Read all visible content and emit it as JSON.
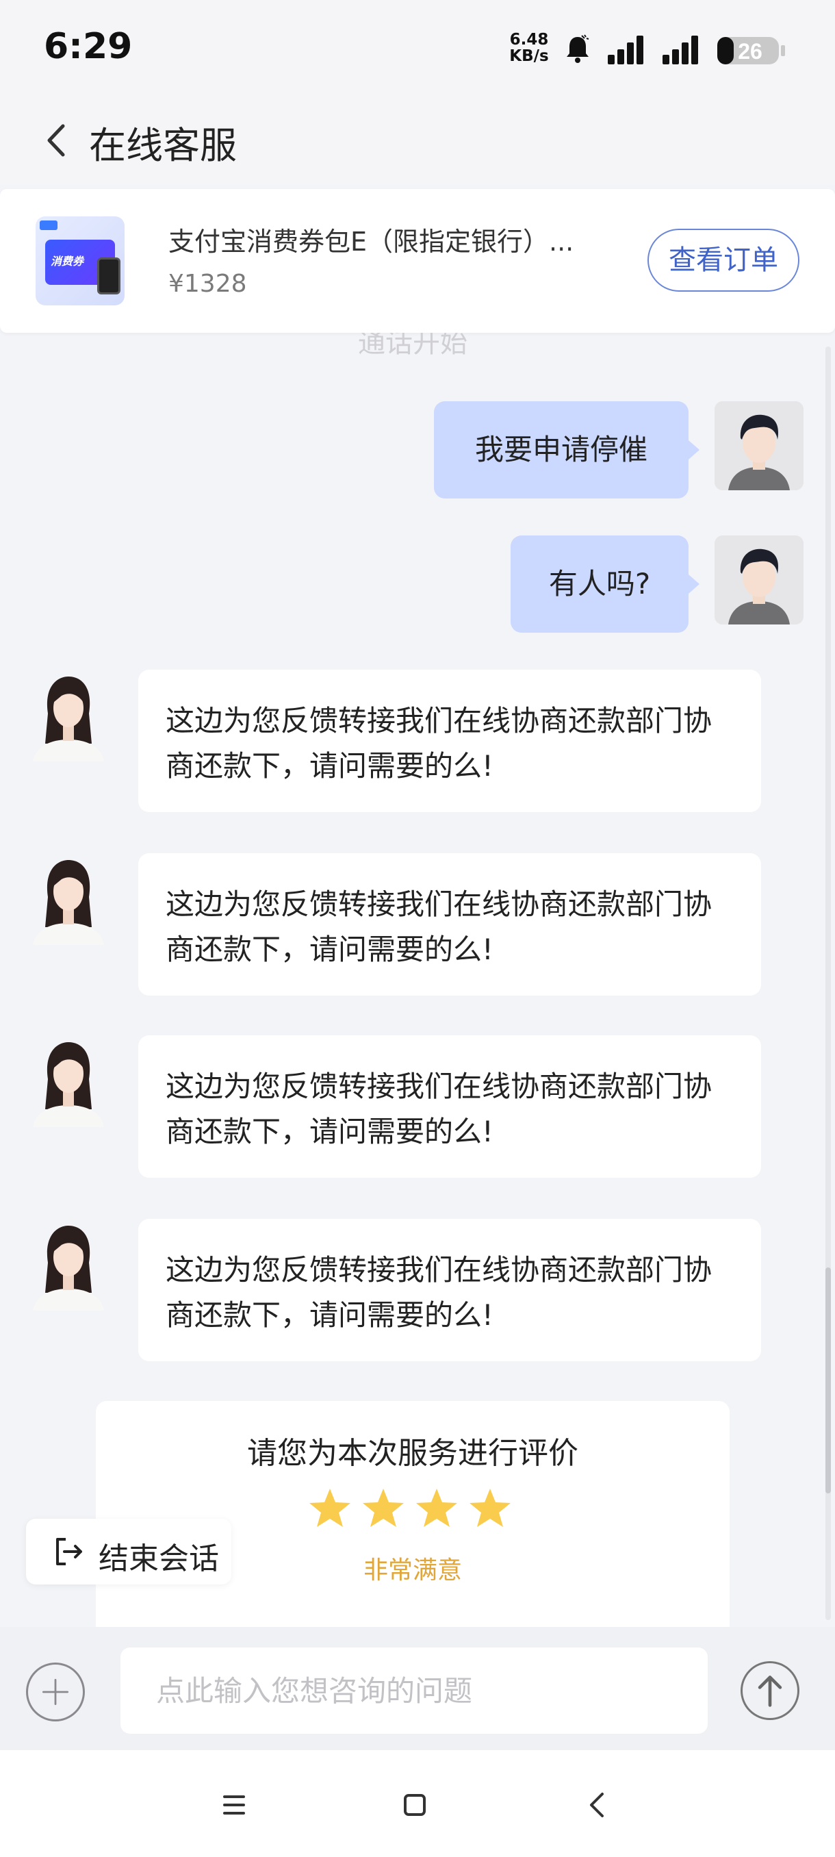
{
  "status_bar": {
    "time": "6:29",
    "net_speed_value": "6.48",
    "net_speed_unit": "KB/s",
    "battery_level": "26",
    "icons": [
      "bell-icon",
      "signal-icon",
      "signal-icon",
      "battery-icon"
    ]
  },
  "header": {
    "title": "在线客服",
    "back_icon": "chevron-left-icon"
  },
  "order": {
    "product_name": "支付宝消费券包E（限指定银行）...",
    "price": "¥1328",
    "view_order_label": "查看订单",
    "thumb_text": "消费券"
  },
  "chat": {
    "notice": "通话开始",
    "user_messages": [
      {
        "text": "我要申请停催"
      },
      {
        "text": "有人吗?"
      }
    ],
    "agent_messages": [
      {
        "text": "这边为您反馈转接我们在线协商还款部门协商还款下，请问需要的么!"
      },
      {
        "text": "这边为您反馈转接我们在线协商还款部门协商还款下，请问需要的么!"
      },
      {
        "text": "这边为您反馈转接我们在线协商还款部门协商还款下，请问需要的么!"
      },
      {
        "text": "这边为您反馈转接我们在线协商还款部门协商还款下，请问需要的么!"
      }
    ]
  },
  "rating": {
    "title": "请您为本次服务进行评价",
    "stars": 4,
    "star_color": "#f9cc4e",
    "label": "非常满意"
  },
  "end_session": {
    "label": "结束会话"
  },
  "input": {
    "placeholder": "点此输入您想咨询的问题"
  },
  "nav": [
    "menu-icon",
    "home-icon",
    "back-icon"
  ]
}
